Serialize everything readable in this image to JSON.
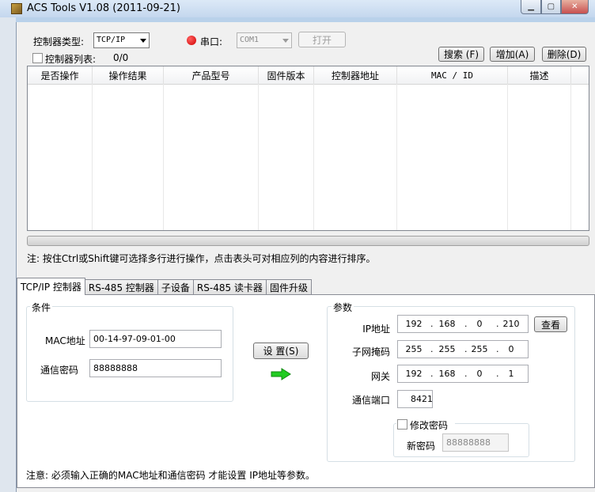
{
  "window": {
    "title": "ACS Tools V1.08 (2011-09-21)"
  },
  "top": {
    "controller_type_label": "控制器类型:",
    "controller_type_value": "TCP/IP",
    "serial_label": "串口:",
    "serial_value": "COM1",
    "open_button": "打开",
    "controller_list_label": "控制器列表:",
    "controller_count": "0/0",
    "search_button": "搜索 (F)",
    "add_button": "增加(A)",
    "delete_button": "删除(D)"
  },
  "table": {
    "columns": [
      "是否操作",
      "操作结果",
      "产品型号",
      "固件版本",
      "控制器地址",
      "MAC / ID",
      "描述"
    ],
    "rows": []
  },
  "note": "注: 按住Ctrl或Shift键可选择多行进行操作，点击表头可对相应列的内容进行排序。",
  "tabs": [
    "TCP/IP 控制器",
    "RS-485 控制器",
    "子设备",
    "RS-485 读卡器",
    "固件升级"
  ],
  "condition": {
    "title": "条件",
    "mac_label": "MAC地址",
    "mac_value": "00-14-97-09-01-00",
    "password_label": "通信密码",
    "password_value": "88888888"
  },
  "set_button": "设 置(S)",
  "params": {
    "title": "参数",
    "ip_label": "IP地址",
    "ip": [
      "192",
      "168",
      "0",
      "210"
    ],
    "view_button": "查看",
    "mask_label": "子网掩码",
    "mask": [
      "255",
      "255",
      "255",
      "0"
    ],
    "gateway_label": "网关",
    "gateway": [
      "192",
      "168",
      "0",
      "1"
    ],
    "port_label": "通信端口",
    "port_value": "8421",
    "change_password_label": "修改密码",
    "new_password_label": "新密码",
    "new_password_value": "88888888"
  },
  "bottom_note": "注意: 必须输入正确的MAC地址和通信密码 才能设置 IP地址等参数。",
  "colors": {
    "led": "#e00000",
    "arrow": "#22cc22",
    "window_frame": "#b9d1ea"
  }
}
